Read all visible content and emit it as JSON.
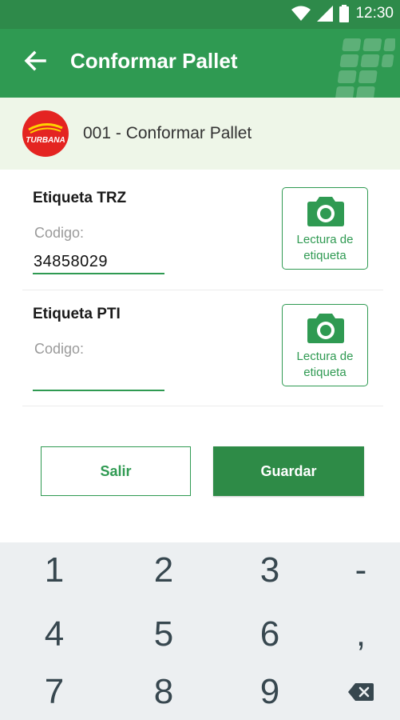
{
  "status_bar": {
    "time": "12:30",
    "icons": [
      "wifi-icon",
      "signal-icon",
      "battery-icon"
    ]
  },
  "app_bar": {
    "title": "Conformar Pallet",
    "back_icon": "arrow-left-icon"
  },
  "subheader": {
    "logo_text": "TURBANA",
    "title": "001 - Conformar Pallet"
  },
  "fields": [
    {
      "label": "Etiqueta TRZ",
      "hint": "Codigo:",
      "value": "34858029",
      "scan_label": "Lectura de\netiqueta"
    },
    {
      "label": "Etiqueta PTI",
      "hint": "Codigo:",
      "value": "",
      "scan_label": "Lectura de\netiqueta"
    }
  ],
  "actions": {
    "exit_label": "Salir",
    "save_label": "Guardar"
  },
  "keyboard": {
    "rows": [
      [
        "1",
        "2",
        "3",
        "-"
      ],
      [
        "4",
        "5",
        "6",
        ","
      ],
      [
        "7",
        "8",
        "9",
        "backspace"
      ]
    ]
  },
  "colors": {
    "primary": "#2f9a52",
    "primary_dark": "#2e8a4a",
    "subheader_bg": "#eef6e8",
    "logo_red": "#e42421",
    "keyboard_bg": "#eceff1"
  }
}
